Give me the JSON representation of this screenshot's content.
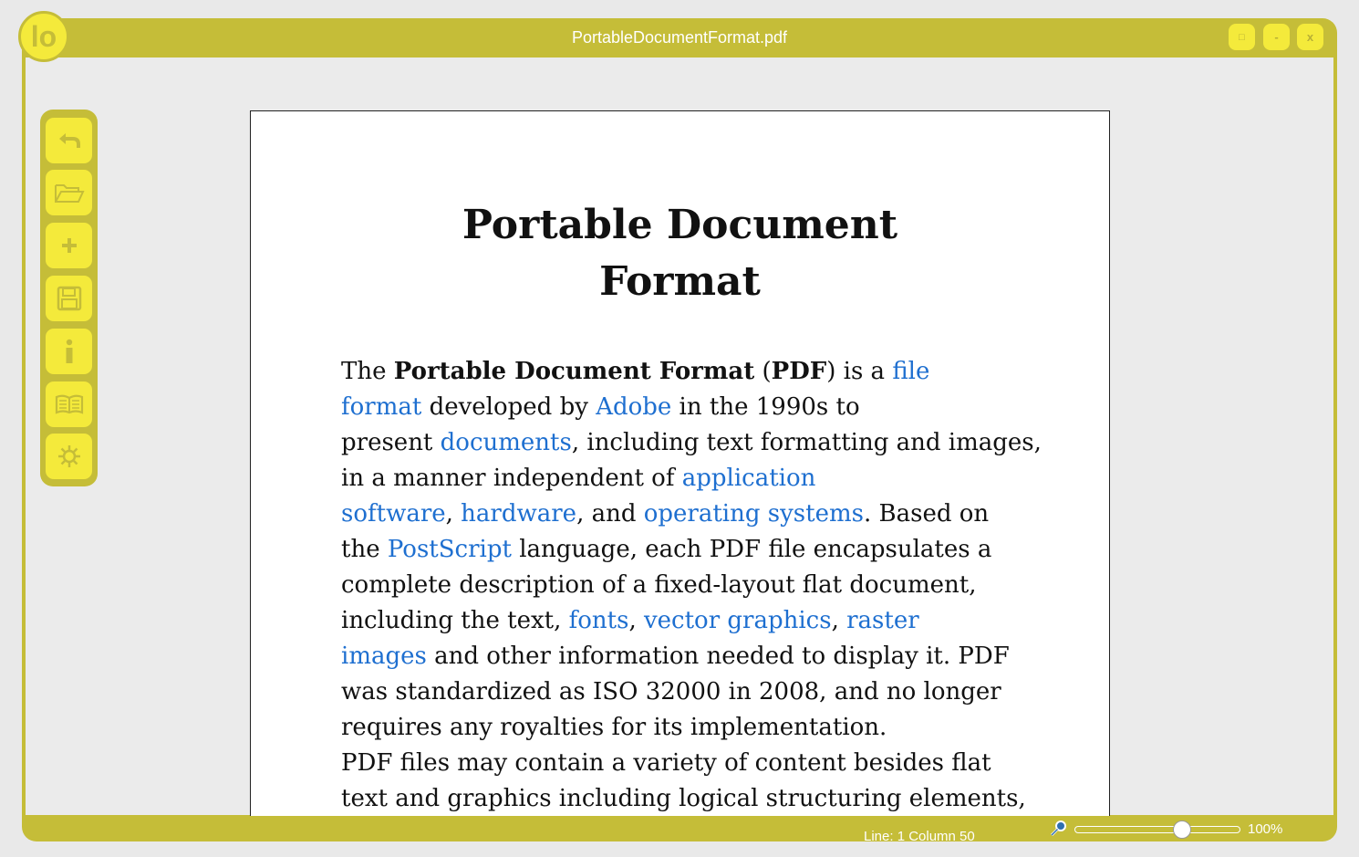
{
  "window": {
    "title": "PortableDocumentFormat.pdf",
    "logo_text": "lo",
    "buttons": [
      {
        "name": "maximize",
        "icon": "maximize-icon",
        "glyph": "□"
      },
      {
        "name": "minimize",
        "icon": "minimize-icon",
        "glyph": "-"
      },
      {
        "name": "close",
        "icon": "close-icon",
        "glyph": "x"
      }
    ]
  },
  "toolbar": {
    "items": [
      {
        "name": "back",
        "icon": "back-arrow-icon"
      },
      {
        "name": "open",
        "icon": "open-folder-icon"
      },
      {
        "name": "new",
        "icon": "plus-icon"
      },
      {
        "name": "save",
        "icon": "floppy-disk-icon"
      },
      {
        "name": "info",
        "icon": "info-icon"
      },
      {
        "name": "reader",
        "icon": "book-icon"
      },
      {
        "name": "settings",
        "icon": "gear-icon"
      }
    ]
  },
  "document": {
    "title_line1": "Portable Document",
    "title_line2": "Format",
    "lines": [
      [
        {
          "t": "The "
        },
        {
          "t": "Portable Document Format",
          "b": true
        },
        {
          "t": " ("
        },
        {
          "t": "PDF",
          "b": true
        },
        {
          "t": ") is a "
        },
        {
          "t": "file",
          "link": true
        }
      ],
      [
        {
          "t": "format",
          "link": true
        },
        {
          "t": " developed by "
        },
        {
          "t": "Adobe",
          "link": true
        },
        {
          "t": " in the 1990s to"
        }
      ],
      [
        {
          "t": "present "
        },
        {
          "t": "documents",
          "link": true
        },
        {
          "t": ", including text formatting and images,"
        }
      ],
      [
        {
          "t": "in a manner independent of "
        },
        {
          "t": "application",
          "link": true
        }
      ],
      [
        {
          "t": "software",
          "link": true
        },
        {
          "t": ", "
        },
        {
          "t": "hardware",
          "link": true
        },
        {
          "t": ", and "
        },
        {
          "t": "operating systems",
          "link": true
        },
        {
          "t": ". Based on"
        }
      ],
      [
        {
          "t": "the "
        },
        {
          "t": "PostScript",
          "link": true
        },
        {
          "t": " language, each PDF file encapsulates a"
        }
      ],
      [
        {
          "t": "complete description of a fixed-layout flat document,"
        }
      ],
      [
        {
          "t": "including the text, "
        },
        {
          "t": "fonts",
          "link": true
        },
        {
          "t": ", "
        },
        {
          "t": "vector graphics",
          "link": true
        },
        {
          "t": ", "
        },
        {
          "t": "raster",
          "link": true
        }
      ],
      [
        {
          "t": "images",
          "link": true
        },
        {
          "t": " and other information needed to display it. PDF"
        }
      ],
      [
        {
          "t": "was standardized as ISO 32000 in 2008, and no longer"
        }
      ],
      [
        {
          "t": "requires any royalties for its implementation."
        }
      ],
      [
        {
          "t": "PDF files may contain a variety of content besides flat"
        }
      ],
      [
        {
          "t": "text and graphics including logical structuring elements,"
        }
      ]
    ]
  },
  "statusbar": {
    "position": "Line: 1  Column 50",
    "zoom_label": "100%",
    "zoom_fraction": 0.65,
    "zoom_icon": "magnifier-icon"
  },
  "colors": {
    "frame": "#c5bd38",
    "button": "#f4ea3b",
    "link": "#1e6fd0"
  }
}
